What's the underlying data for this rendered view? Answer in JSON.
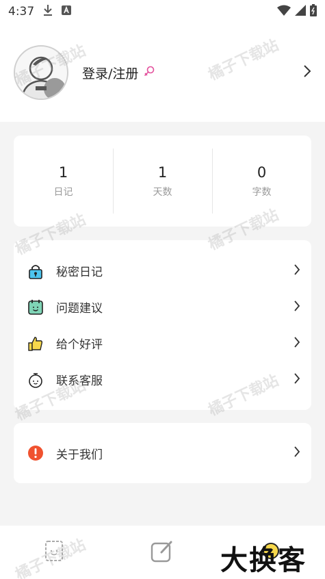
{
  "status_bar": {
    "time": "4:37"
  },
  "profile": {
    "login_label": "登录/注册"
  },
  "stats": [
    {
      "value": "1",
      "label": "日记"
    },
    {
      "value": "1",
      "label": "天数"
    },
    {
      "value": "0",
      "label": "字数"
    }
  ],
  "menu": [
    {
      "label": "秘密日记",
      "icon": "lock-icon"
    },
    {
      "label": "问题建议",
      "icon": "calendar-smile-icon"
    },
    {
      "label": "给个好评",
      "icon": "thumbs-up-icon"
    },
    {
      "label": "联系客服",
      "icon": "stopwatch-face-icon"
    }
  ],
  "about": {
    "label": "关于我们",
    "icon": "alert-icon"
  },
  "watermark_text": "橘子下载站",
  "logo_text": "大换客",
  "colors": {
    "accent_teal": "#3aa89a",
    "alert_red": "#f0522f",
    "thumb_yellow": "#f7d84b",
    "lock_blue": "#4cc4ee"
  }
}
